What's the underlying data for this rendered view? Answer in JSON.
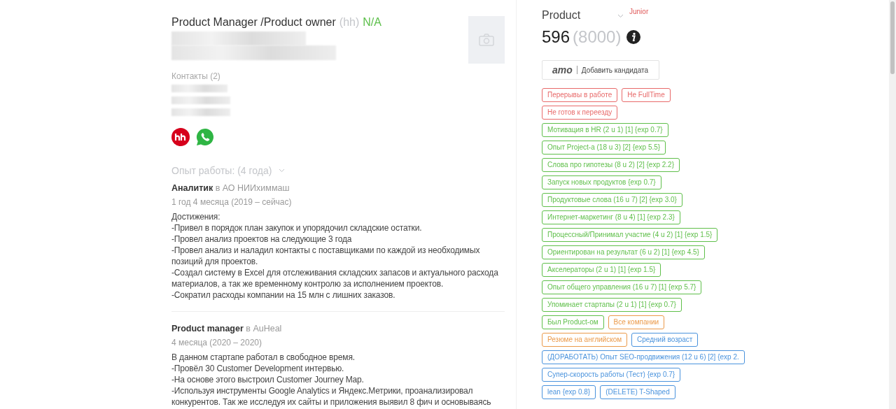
{
  "candidate": {
    "title": "Product Manager /Product owner",
    "source": "(hh)",
    "status": "N/A",
    "contacts_label": "Контакты (2)"
  },
  "experience_header": "Опыт работы: (4 года)",
  "jobs": [
    {
      "position": "Аналитик",
      "company": "в АО НИИхиммаш",
      "period": "1 год 4 месяца (2019 – сейчас)",
      "lines": [
        "Достижения:",
        "-Привел в порядок план закупок и упорядочил складские остатки.",
        "-Провел анализ проектов на следующие 3 года",
        "-Провел анализ и наладил контакты с поставщиками по каждой из необходимых позиций для проектов.",
        "-Создал систему в Excel для отслеживания складских запасов и актуального расхода материалов, а так же временному контролю за исполнением проектов.",
        "-Сократил расходы компании на 15 млн с лишних заказов."
      ]
    },
    {
      "position": "Product manager",
      "company": "в AuHeal",
      "period": "4 месяца (2020 – 2020)",
      "lines": [
        "В данном стартапе работал в свободное время.",
        "-Провёл 30 Customer Development интервью.",
        "-На основе этого выстроил Customer Journey Map.",
        "-Используя инструменты Google Analytics и Яндекс.Метрики, проанализировал конкурентов. Так же исследуя их сайты и приложения выявил 8 фич и основываясь"
      ]
    }
  ],
  "vacancy": {
    "name": "Product",
    "level": "Junior",
    "count": "596",
    "total": "(8000)"
  },
  "add_button": {
    "logo": "amo",
    "label": "Добавить кандидата"
  },
  "tags": [
    {
      "text": "Перерывы в работе",
      "color": "#e86a6a"
    },
    {
      "text": "Не FullTime",
      "color": "#e86a6a"
    },
    {
      "text": "Не готов к переезду",
      "color": "#e86a6a"
    },
    {
      "text": "Мотивация в HR (2 u 1) [1] {exp 0.7}",
      "color": "#5fbf4a"
    },
    {
      "text": "Опыт Project-а (18 u 3) [2] {exp 5.5}",
      "color": "#5fbf4a"
    },
    {
      "text": "Слова про гипотезы (8 u 2) [2] {exp 2.2}",
      "color": "#5fbf4a"
    },
    {
      "text": "Запуск новых продуктов {exp 0.7}",
      "color": "#5fbf4a"
    },
    {
      "text": "Продуктовые слова (16 u 7) [2] {exp 3.0}",
      "color": "#5fbf4a"
    },
    {
      "text": "Интернет-маркетинг (8 u 4) [1] {exp 2.3}",
      "color": "#5fbf4a"
    },
    {
      "text": "Процессный/Принимал участие (4 u 2) [1] {exp 1.5}",
      "color": "#5fbf4a"
    },
    {
      "text": "Ориентирован на результат (6 u 2) [1] {exp 4.5}",
      "color": "#5fbf4a"
    },
    {
      "text": "Акселераторы (2 u 1) [1] {exp 1.5}",
      "color": "#5fbf4a"
    },
    {
      "text": "Опыт общего управления (16 u 7) [1] {exp 5.7}",
      "color": "#5fbf4a"
    },
    {
      "text": "Упоминает стартапы (2 u 1) [1] {exp 0.7}",
      "color": "#5fbf4a"
    },
    {
      "text": "Был Product-ом",
      "color": "#5fbf4a"
    },
    {
      "text": "Все компании",
      "color": "#eb9a4a"
    },
    {
      "text": "Резюме на английском",
      "color": "#eb9a4a"
    },
    {
      "text": "Средний возраст",
      "color": "#4a93dd"
    },
    {
      "text": "(ДОРАБОТАТЬ) Опыт SEO-продвижения (12 u 6) [2] {exp 2.",
      "color": "#4a93dd"
    },
    {
      "text": "Супер-скорость работы (Тест) {exp 0.7}",
      "color": "#4a93dd"
    },
    {
      "text": "lean {exp 0.8}",
      "color": "#4a93dd"
    },
    {
      "text": "(DELETE) T-Shaped",
      "color": "#4a93dd"
    }
  ]
}
